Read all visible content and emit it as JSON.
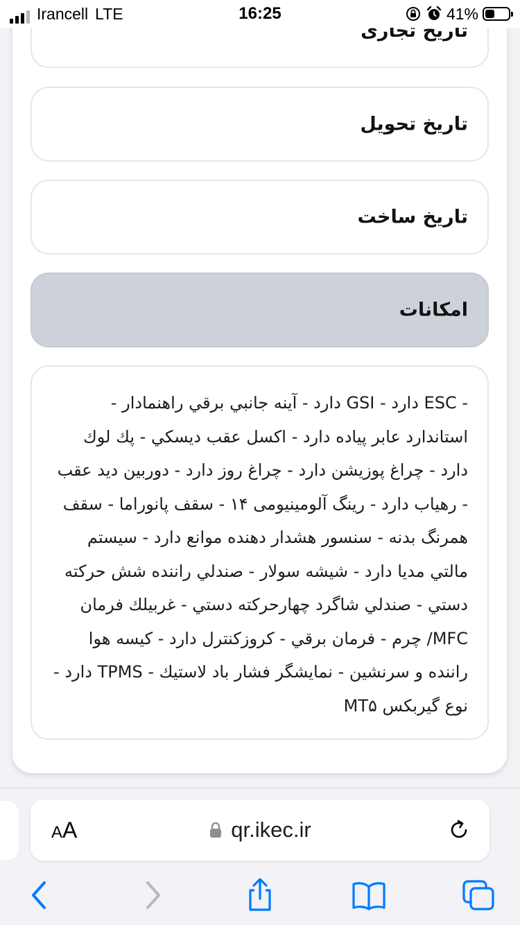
{
  "status_bar": {
    "carrier": "Irancell",
    "network": "LTE",
    "time": "16:25",
    "battery_percent": "41%",
    "battery_level": 0.41,
    "icons": [
      "screen-rotation-lock-icon",
      "alarm-icon"
    ]
  },
  "fields": {
    "commercial_date": "تاریخ تجاری",
    "delivery_date": "تاریخ تحویل",
    "manufacture_date": "تاریخ ساخت",
    "features_header": "امکانات"
  },
  "features": {
    "text": "- ESC دارد - GSI دارد - آينه جانبي برقي راهنمادار - استاندارد عابر پیاده دارد - اكسل عقب ديسكي - پك لوك دارد - چراغ پوزيشن دارد - چراغ روز دارد - دوربين ديد عقب - رهياب دارد - رينگ آلومینیومی ۱۴ - سقف پانوراما - سقف همرنگ بدنه - سنسور هشدار دهنده موانع دارد - سيستم مالتي مديا دارد - شيشه سولار - صندلي راننده شش حركته دستي - صندلي شاگرد چهارحركته دستي - غربيلك فرمان MFC/ چرم - فرمان برقي - كروزكنترل دارد - كيسه هوا راننده و سرنشين - نمايشگر فشار باد لاستيك - TPMS دارد - نوع گيربكس MT۵"
  },
  "browser": {
    "aa_small": "A",
    "aa_big": "A",
    "url": "qr.ikec.ir",
    "accent_color": "#007aff"
  }
}
